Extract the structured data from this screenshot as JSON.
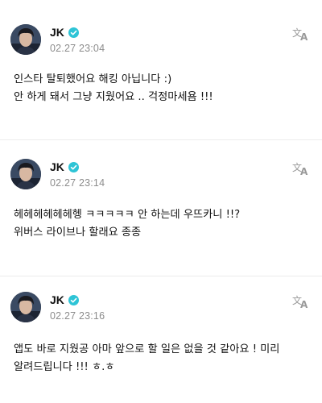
{
  "posts": [
    {
      "author": "JK",
      "timestamp": "02.27 23:04",
      "lines": [
        "인스타 탈퇴했어요 해킹 아닙니다 :)",
        "안 하게 돼서 그냥 지웠어요 .. 걱정마세욤 !!!"
      ]
    },
    {
      "author": "JK",
      "timestamp": "02.27 23:14",
      "lines": [
        "헤헤헤헤헤헤헹 ㅋㅋㅋㅋㅋ 안 하는데 우뜨카니 !!?",
        "위버스 라이브나 할래요 종종"
      ]
    },
    {
      "author": "JK",
      "timestamp": "02.27 23:16",
      "lines": [
        "앱도 바로 지웠공 아마 앞으로 할 일은 없을 것 같아요 ! 미리",
        "알려드립니다 !!! ㅎ.ㅎ"
      ]
    }
  ],
  "icons": {
    "verified": "verified-badge-icon",
    "translate": "translate-icon"
  },
  "colors": {
    "verified": "#2ec4d6",
    "translate_icon": "#9a9a9a",
    "timestamp": "#8c8c8c"
  }
}
